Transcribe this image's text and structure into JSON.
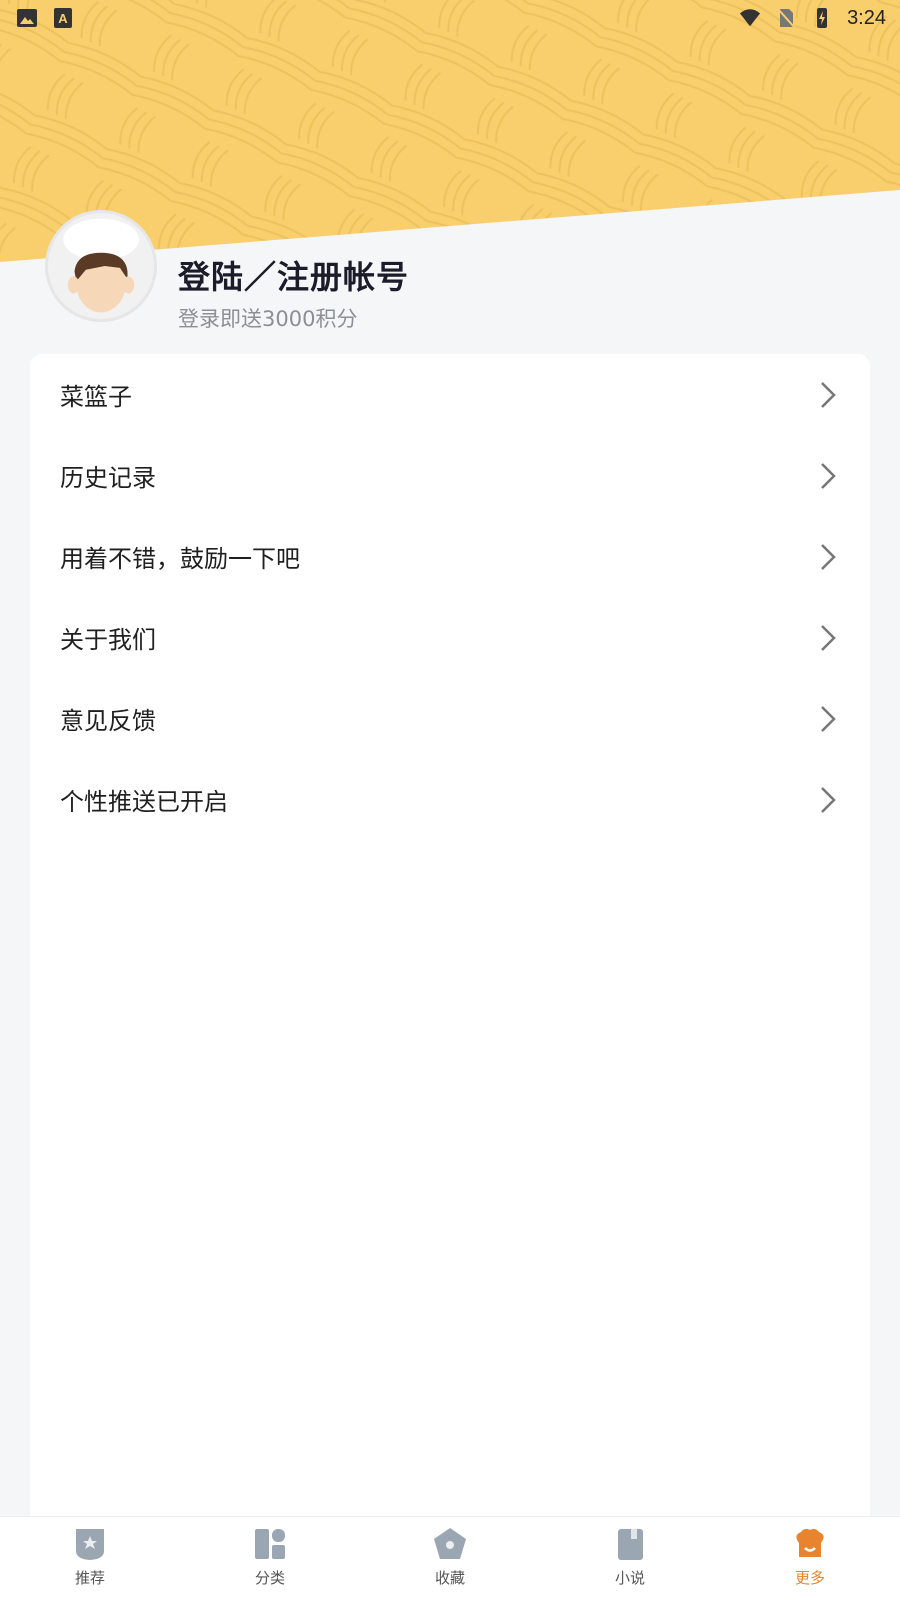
{
  "status_bar": {
    "time": "3:24",
    "icons": [
      "image-icon",
      "text-a-icon",
      "wifi-icon",
      "no-sim-icon",
      "battery-charging-icon"
    ]
  },
  "profile": {
    "title": "登陆／注册帐号",
    "subtitle": "登录即送3000积分",
    "avatar_icon": "chef-avatar-icon"
  },
  "menu": {
    "items": [
      {
        "label": "菜篮子"
      },
      {
        "label": "历史记录"
      },
      {
        "label": "用着不错，鼓励一下吧"
      },
      {
        "label": "关于我们"
      },
      {
        "label": "意见反馈"
      },
      {
        "label": "个性推送已开启"
      }
    ]
  },
  "bottom_nav": {
    "items": [
      {
        "label": "推荐",
        "icon": "recommend-icon",
        "active": false
      },
      {
        "label": "分类",
        "icon": "category-icon",
        "active": false
      },
      {
        "label": "收藏",
        "icon": "favorite-icon",
        "active": false
      },
      {
        "label": "小说",
        "icon": "novel-icon",
        "active": false
      },
      {
        "label": "更多",
        "icon": "chef-hat-icon",
        "active": true
      }
    ]
  },
  "colors": {
    "banner": "#f8cf6c",
    "accent": "#e8832e",
    "inactive_icon": "#9aa6b2"
  }
}
